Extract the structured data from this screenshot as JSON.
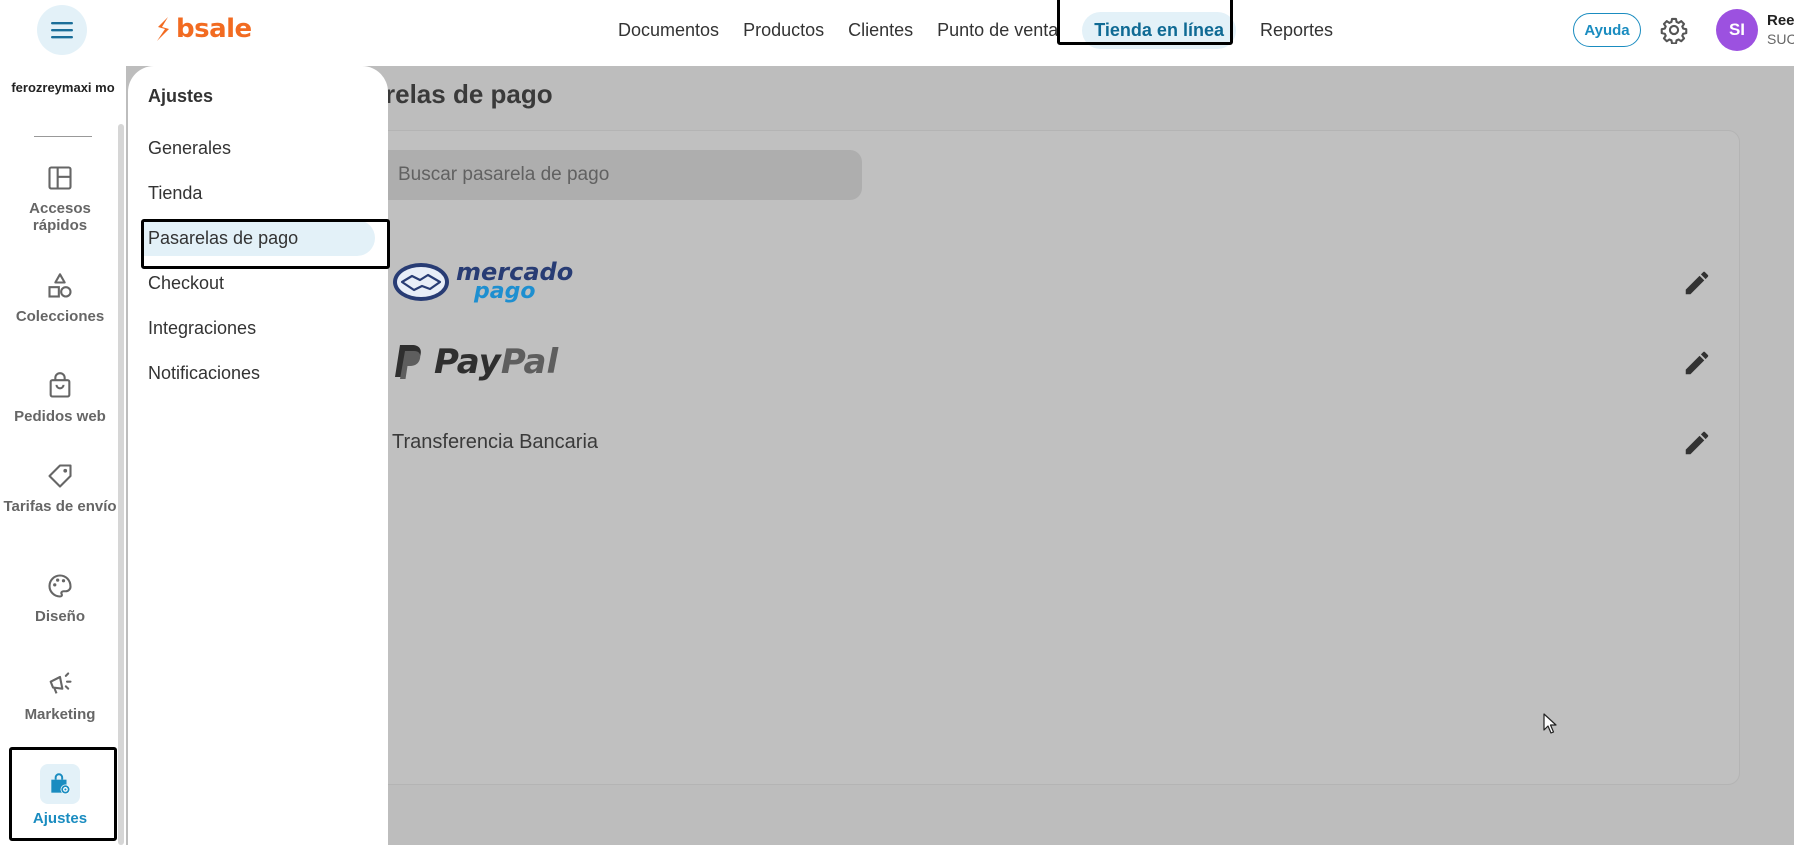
{
  "brand": {
    "name": "bsale",
    "accent": "#f26b21"
  },
  "topnav": {
    "items": [
      {
        "label": "Documentos"
      },
      {
        "label": "Productos"
      },
      {
        "label": "Clientes"
      },
      {
        "label": "Punto de venta"
      },
      {
        "label": "Tienda en línea",
        "active": true
      },
      {
        "label": "Reportes"
      }
    ],
    "help_label": "Ayuda",
    "settings_icon": "gear-icon",
    "menu_icon": "hamburger-icon"
  },
  "user": {
    "initials": "SI",
    "name": "Ree",
    "sub": "SUC",
    "avatar_color": "#9c51e0"
  },
  "sidebar": {
    "account": "ferozreymaxi mo",
    "items": [
      {
        "label": "Accesos rápidos",
        "icon": "layout-icon"
      },
      {
        "label": "Colecciones",
        "icon": "shapes-icon"
      },
      {
        "label": "Pedidos web",
        "icon": "shopping-bag-icon"
      },
      {
        "label": "Tarifas de envío",
        "icon": "tag-icon"
      },
      {
        "label": "Diseño",
        "icon": "palette-icon"
      },
      {
        "label": "Marketing",
        "icon": "megaphone-icon"
      },
      {
        "label": "Ajustes",
        "icon": "bag-settings-icon",
        "active": true
      }
    ]
  },
  "submenu": {
    "title": "Ajustes",
    "items": [
      {
        "label": "Generales"
      },
      {
        "label": "Tienda"
      },
      {
        "label": "Pasarelas de pago",
        "active": true
      },
      {
        "label": "Checkout"
      },
      {
        "label": "Integraciones"
      },
      {
        "label": "Notificaciones"
      }
    ]
  },
  "main": {
    "title": "relas de pago",
    "search_placeholder": "Buscar pasarela de pago",
    "gateways": [
      {
        "name": "mercado pago",
        "logo_line1": "mercado",
        "logo_line2": "pago"
      },
      {
        "name": "PayPal",
        "logo_part1": "Pay",
        "logo_part2": "Pal"
      },
      {
        "name": "Transferencia Bancaria"
      }
    ]
  },
  "colors": {
    "active_blue": "#1a8cc0",
    "active_bg": "#e3f1f8",
    "overlay": "#bdbdbd"
  }
}
